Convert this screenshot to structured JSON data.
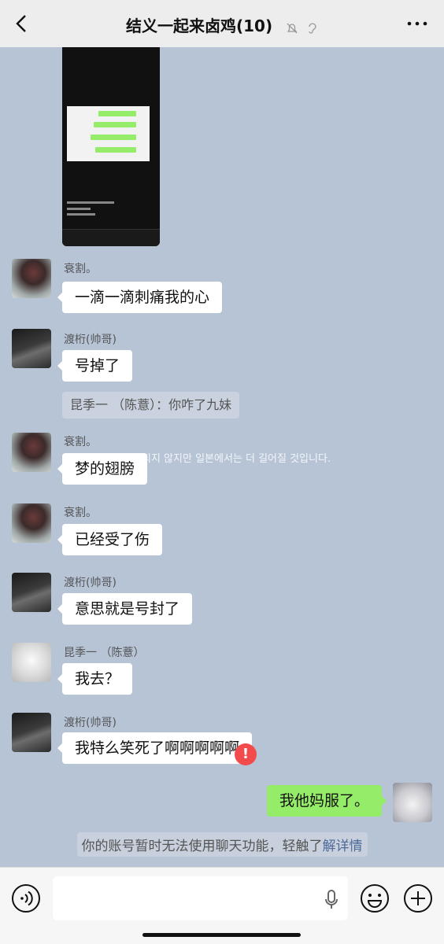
{
  "header": {
    "title": "结义一起来卤鸡(10)",
    "icons": [
      "back-icon",
      "mute-bell-icon",
      "ear-icon",
      "more-icon"
    ]
  },
  "messages": [
    {
      "type": "image",
      "sender": "",
      "content": "shared screenshot"
    },
    {
      "type": "text",
      "sender": "衰割。",
      "text": "一滴一滴刺痛我的心"
    },
    {
      "type": "text",
      "sender": "渡桁(帅哥)",
      "text": "号掉了"
    },
    {
      "type": "quote",
      "text": "昆季一 （陈薏）：你咋了九妹"
    },
    {
      "type": "text",
      "sender": "衰割。",
      "text": "梦的翅膀"
    },
    {
      "type": "text",
      "sender": "衰割。",
      "text": "已经受了伤"
    },
    {
      "type": "text",
      "sender": "渡桁(帅哥)",
      "text": "意思就是号封了"
    },
    {
      "type": "text",
      "sender": "昆季一 （陈薏）",
      "text": "我去？"
    },
    {
      "type": "text",
      "sender": "渡桁(帅哥)",
      "text": "我特么笑死了啊啊啊啊啊"
    },
    {
      "type": "self",
      "text": "我他妈服了。",
      "status": "!"
    }
  ],
  "watermark": "되지 않지만 일본에서는 더 길어질 것입니다.",
  "system_note": {
    "text": "你的账号暂时无法使用聊天功能，轻触了",
    "link": "解详情"
  },
  "colors": {
    "chat_bg": "#b6c4d6",
    "self_bubble": "#95ec69",
    "error": "#f24b4b",
    "link": "#4d6a99"
  }
}
